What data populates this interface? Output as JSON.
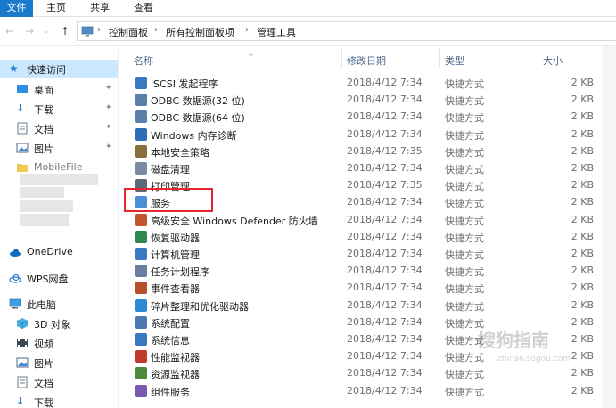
{
  "ribbon": {
    "tabs": [
      {
        "label": "文件",
        "active": true
      },
      {
        "label": "主页",
        "active": false
      },
      {
        "label": "共享",
        "active": false
      },
      {
        "label": "查看",
        "active": false
      }
    ]
  },
  "address": {
    "crumbs": [
      "控制面板",
      "所有控制面板项",
      "管理工具"
    ]
  },
  "sidebar": {
    "items": [
      {
        "label": "快速访问",
        "icon": "star-icon",
        "pinned": false,
        "selected": true
      },
      {
        "label": "桌面",
        "icon": "desktop-icon",
        "pinned": true
      },
      {
        "label": "下载",
        "icon": "download-icon",
        "pinned": true
      },
      {
        "label": "文档",
        "icon": "document-icon",
        "pinned": true
      },
      {
        "label": "图片",
        "icon": "picture-icon",
        "pinned": true
      },
      {
        "label": "MobileFile",
        "icon": "folder-icon",
        "pinned": false
      },
      {
        "label": "OneDrive",
        "icon": "cloud-icon",
        "pinned": false
      },
      {
        "label": "WPS网盘",
        "icon": "cloud-drive-icon",
        "pinned": false
      },
      {
        "label": "此电脑",
        "icon": "computer-icon",
        "pinned": false
      },
      {
        "label": "3D 对象",
        "icon": "cube-icon",
        "pinned": false
      },
      {
        "label": "视频",
        "icon": "video-icon",
        "pinned": false
      },
      {
        "label": "图片",
        "icon": "picture-icon",
        "pinned": false
      },
      {
        "label": "文档",
        "icon": "document-icon",
        "pinned": false
      },
      {
        "label": "下载",
        "icon": "download-icon",
        "pinned": false
      }
    ]
  },
  "list": {
    "columns": {
      "name": "名称",
      "date": "修改日期",
      "type": "类型",
      "size": "大小"
    },
    "rows": [
      {
        "name": "iSCSI 发起程序",
        "date": "2018/4/12 7:34",
        "type": "快捷方式",
        "size": "2 KB",
        "icon": "globe-shortcut-icon"
      },
      {
        "name": "ODBC 数据源(32 位)",
        "date": "2018/4/12 7:34",
        "type": "快捷方式",
        "size": "2 KB",
        "icon": "database-icon"
      },
      {
        "name": "ODBC 数据源(64 位)",
        "date": "2018/4/12 7:34",
        "type": "快捷方式",
        "size": "2 KB",
        "icon": "database-icon"
      },
      {
        "name": "Windows 内存诊断",
        "date": "2018/4/12 7:34",
        "type": "快捷方式",
        "size": "2 KB",
        "icon": "memory-diagnostic-icon"
      },
      {
        "name": "本地安全策略",
        "date": "2018/4/12 7:35",
        "type": "快捷方式",
        "size": "2 KB",
        "icon": "security-policy-icon"
      },
      {
        "name": "磁盘清理",
        "date": "2018/4/12 7:34",
        "type": "快捷方式",
        "size": "2 KB",
        "icon": "disk-cleanup-icon"
      },
      {
        "name": "打印管理",
        "date": "2018/4/12 7:35",
        "type": "快捷方式",
        "size": "2 KB",
        "icon": "printer-icon"
      },
      {
        "name": "服务",
        "date": "2018/4/12 7:34",
        "type": "快捷方式",
        "size": "2 KB",
        "icon": "services-gear-icon",
        "highlighted": true
      },
      {
        "name": "高级安全 Windows Defender 防火墙",
        "date": "2018/4/12 7:34",
        "type": "快捷方式",
        "size": "2 KB",
        "icon": "firewall-icon"
      },
      {
        "name": "恢复驱动器",
        "date": "2018/4/12 7:34",
        "type": "快捷方式",
        "size": "2 KB",
        "icon": "recovery-drive-icon"
      },
      {
        "name": "计算机管理",
        "date": "2018/4/12 7:34",
        "type": "快捷方式",
        "size": "2 KB",
        "icon": "computer-management-icon"
      },
      {
        "name": "任务计划程序",
        "date": "2018/4/12 7:34",
        "type": "快捷方式",
        "size": "2 KB",
        "icon": "task-scheduler-icon"
      },
      {
        "name": "事件查看器",
        "date": "2018/4/12 7:34",
        "type": "快捷方式",
        "size": "2 KB",
        "icon": "event-viewer-icon"
      },
      {
        "name": "碎片整理和优化驱动器",
        "date": "2018/4/12 7:34",
        "type": "快捷方式",
        "size": "2 KB",
        "icon": "defrag-icon"
      },
      {
        "name": "系统配置",
        "date": "2018/4/12 7:34",
        "type": "快捷方式",
        "size": "2 KB",
        "icon": "system-config-icon"
      },
      {
        "name": "系统信息",
        "date": "2018/4/12 7:34",
        "type": "快捷方式",
        "size": "2 KB",
        "icon": "system-info-icon"
      },
      {
        "name": "性能监视器",
        "date": "2018/4/12 7:34",
        "type": "快捷方式",
        "size": "2 KB",
        "icon": "performance-monitor-icon"
      },
      {
        "name": "资源监视器",
        "date": "2018/4/12 7:34",
        "type": "快捷方式",
        "size": "2 KB",
        "icon": "resource-monitor-icon"
      },
      {
        "name": "组件服务",
        "date": "2018/4/12 7:34",
        "type": "快捷方式",
        "size": "2 KB",
        "icon": "component-services-icon"
      }
    ]
  },
  "watermark": {
    "text": "搜狗指南",
    "sub": "zhinan.sogou.com"
  },
  "colors": {
    "accent": "#1979ca",
    "selection": "#cce8ff",
    "highlight_box": "#e8262b"
  }
}
